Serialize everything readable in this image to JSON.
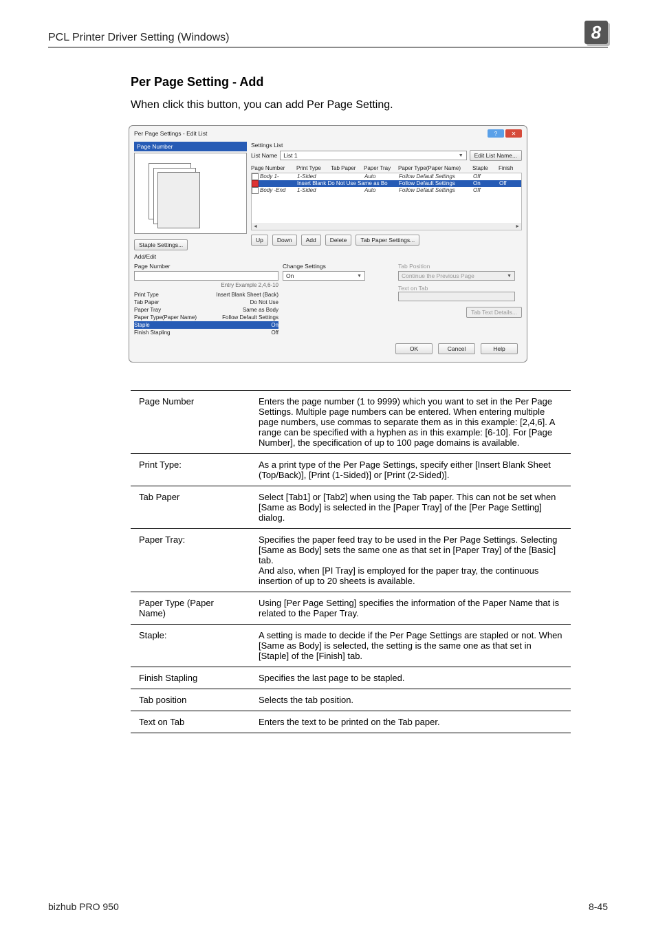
{
  "header": {
    "title": "PCL Printer Driver Setting (Windows)",
    "chapter": "8"
  },
  "section": {
    "title": "Per Page Setting - Add",
    "intro": "When click this button, you can add Per Page Setting."
  },
  "dialog": {
    "window_title": "Per Page Settings - Edit List",
    "preview_caption": "Page Number",
    "staple_btn": "Staple Settings...",
    "settings_list_label": "Settings List",
    "list_name_label": "List Name",
    "list_name_value": "List 1",
    "edit_list_name_btn": "Edit List Name...",
    "grid": {
      "cols": [
        "Page Number",
        "Print Type",
        "Tab Paper",
        "Paper Tray",
        "Paper Type(Paper Name)",
        "Staple",
        "Finish"
      ],
      "rows": [
        {
          "pn": "Body 1-",
          "pt": "1-Sided",
          "tab": "",
          "tray": "Auto",
          "paper": "Follow Default Settings",
          "staple": "Off",
          "finish": "",
          "selected": false
        },
        {
          "pn": "",
          "pt": "Insert Blank Do Not Use Same as Bo",
          "tab": "",
          "tray": "",
          "paper": "Follow Default Settings",
          "staple": "On",
          "finish": "Off",
          "selected": true
        },
        {
          "pn": "Body -End",
          "pt": "1-Sided",
          "tab": "",
          "tray": "Auto",
          "paper": "Follow Default Settings",
          "staple": "Off",
          "finish": "",
          "selected": false
        }
      ]
    },
    "btns": {
      "up": "Up",
      "down": "Down",
      "add": "Add",
      "delete": "Delete",
      "tabpaper": "Tab Paper Settings..."
    },
    "add_edit_label": "Add/Edit",
    "page_number_label": "Page Number",
    "entry_example": "Entry Example 2,4,6-10",
    "kv": {
      "print_type_label": "Print Type",
      "print_type_value": "Insert Blank Sheet (Back)",
      "tab_paper_label": "Tab Paper",
      "tab_paper_value": "Do Not Use",
      "paper_tray_label": "Paper Tray",
      "paper_tray_value": "Same as Body",
      "paper_type_label": "Paper Type(Paper Name)",
      "paper_type_value": "Follow Default Settings",
      "staple_label": "Staple",
      "staple_value": "On",
      "finish_label": "Finish Stapling",
      "finish_value": "Off"
    },
    "change_settings_label": "Change Settings",
    "change_settings_value": "On",
    "tab_position_label": "Tab Position",
    "continue_prev": "Continue the Previous Page",
    "text_on_tab_label": "Text on Tab",
    "tab_text_details_btn": "Tab Text  Details...",
    "ok": "OK",
    "cancel": "Cancel",
    "help": "Help"
  },
  "table": [
    {
      "label": "Page Number",
      "desc": "Enters the page number (1 to 9999) which you want to set in the Per Page Settings. Multiple page numbers can be entered. When entering multiple page numbers, use commas to separate them as in this example: [2,4,6]. A range can be specified with a hyphen as in this example: [6-10]. For [Page Number], the specification of up to 100 page domains is available."
    },
    {
      "label": "Print Type:",
      "desc": "As a print type of the Per Page Settings, specify either [Insert Blank Sheet (Top/Back)], [Print (1-Sided)] or [Print (2-Sided)]."
    },
    {
      "label": "Tab Paper",
      "desc": "Select [Tab1] or [Tab2] when using the Tab paper. This can not be set when [Same as Body] is selected in the [Paper Tray] of the [Per Page Setting] dialog."
    },
    {
      "label": "Paper Tray:",
      "desc": "Specifies the paper feed tray to be used in the Per Page Settings. Selecting [Same as Body] sets the same one as that set in [Paper Tray] of the [Basic] tab.\nAnd also, when [PI Tray] is employed for the paper tray, the continuous insertion of up to 20 sheets is available."
    },
    {
      "label": "Paper Type (Paper Name)",
      "desc": "Using [Per Page Setting] specifies the information of the Paper Name that is related to the Paper Tray."
    },
    {
      "label": "Staple:",
      "desc": "A setting is made to decide if the Per Page Settings are stapled or not. When [Same as Body] is selected, the setting is the same one as that set in [Staple] of the [Finish] tab."
    },
    {
      "label": "Finish Stapling",
      "desc": "Specifies the last page to be stapled."
    },
    {
      "label": "Tab position",
      "desc": "Selects the tab position."
    },
    {
      "label": "Text on Tab",
      "desc": "Enters the text to be printed on the Tab paper."
    }
  ],
  "footer": {
    "left": "bizhub PRO 950",
    "right": "8-45"
  }
}
